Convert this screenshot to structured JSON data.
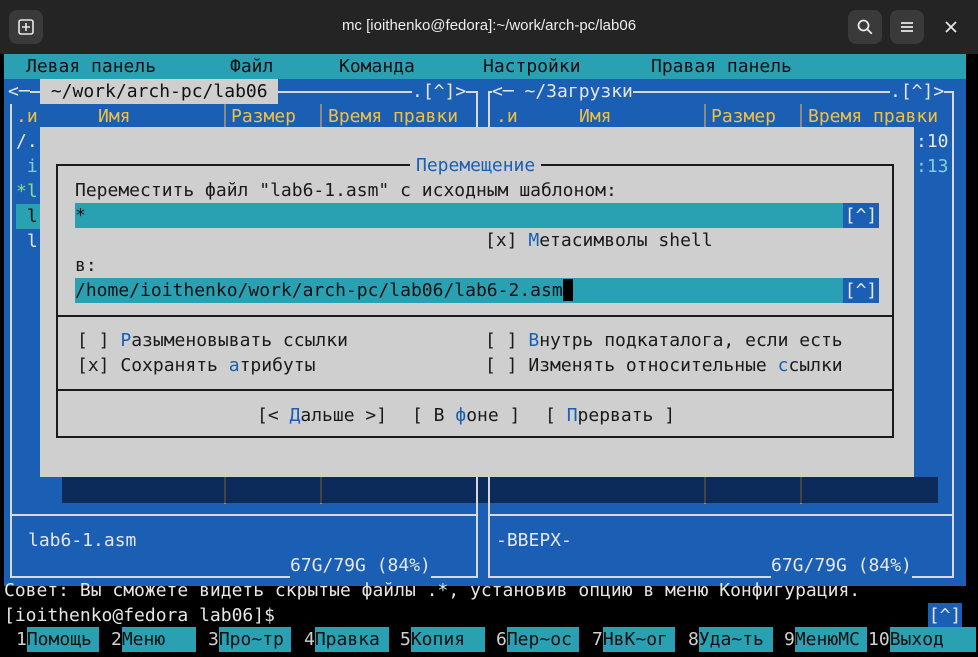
{
  "window": {
    "title": "mc [ioithenko@fedora]:~/work/arch-pc/lab06",
    "new_tab_icon": "⊞",
    "search_icon": "⌕",
    "menu_icon": "☰",
    "close_icon": "✕"
  },
  "menubar": [
    "Левая панель",
    "Файл",
    "Команда",
    "Настройки",
    "Правая панель"
  ],
  "left_panel": {
    "path": " ~/work/arch-pc/lab06 ",
    "header_left": "<─",
    "header_right": ".[^]>",
    "col_n": ".и",
    "col_name": "Имя",
    "col_size": "Размер",
    "col_mtime": "Время правки",
    "frag": [
      "/.",
      " i",
      "*l",
      " l",
      " l"
    ],
    "status_name": "lab6-1.asm",
    "disk": "67G/79G (84%)"
  },
  "right_panel": {
    "path": "<─ ~/Загрузки",
    "header_right": ".[^]>",
    "col_n": ".и",
    "col_name": "Имя",
    "col_size": "Размер",
    "col_mtime": "Время правки",
    "frag": [
      ":10",
      ":13"
    ],
    "status_name": "-ВВЕРХ-",
    "disk": "67G/79G (84%)"
  },
  "dialog": {
    "title": "Перемещение",
    "prompt": "Переместить файл \"lab6-1.asm\" с исходным шаблоном:",
    "source_value": "*",
    "history_btn": "[^]",
    "shell_meta": {
      "box": "[x]",
      "hot": "М",
      "rest": "етасимволы shell"
    },
    "to_label": "в:",
    "dest_value": "/home/ioithenko/work/arch-pc/lab06/lab6-2.asm",
    "dereference": {
      "box": "[ ]",
      "hot": "Р",
      "rest": "азыменовывать ссылки"
    },
    "preserve": {
      "box": "[x]",
      "pre": "Сохранять ",
      "hot": "а",
      "rest": "трибуты"
    },
    "into_subdir": {
      "box": "[ ]",
      "hot": "В",
      "rest": "нутрь подкаталога, если есть"
    },
    "relative": {
      "box": "[ ]",
      "pre": "Изменять относительные ",
      "hot": "с",
      "rest": "сылки"
    },
    "btn_next": {
      "pre": "[< ",
      "hot": "Д",
      "rest": "альше >]"
    },
    "btn_bg": {
      "pre": "[ В ",
      "hot": "ф",
      "rest": "оне ]"
    },
    "btn_abort": {
      "pre": "[ ",
      "hot": "П",
      "rest": "рервать ]"
    }
  },
  "hint": "Совет: Вы сможете видеть скрытые файлы .*, установив опцию в меню Конфигурация.",
  "prompt": "[ioithenko@fedora lab06]$",
  "prompt_hist": "[^]",
  "fkeys": [
    {
      "n": "1",
      "label": "Помощь"
    },
    {
      "n": "2",
      "label": "Меню"
    },
    {
      "n": "3",
      "label": "Про~тр"
    },
    {
      "n": "4",
      "label": "Правка"
    },
    {
      "n": "5",
      "label": "Копия"
    },
    {
      "n": "6",
      "label": "Пер~ос"
    },
    {
      "n": "7",
      "label": "НвК~ог"
    },
    {
      "n": "8",
      "label": "Уда~ть"
    },
    {
      "n": "9",
      "label": "МенюMC"
    },
    {
      "n": "10",
      "label": "Выход"
    }
  ],
  "colors": {
    "panel_bg": "#1a5fb4",
    "bar": "#2aa1b3",
    "dialog_bg": "#cfcfcf",
    "hotkey": "#1a5fb4"
  }
}
